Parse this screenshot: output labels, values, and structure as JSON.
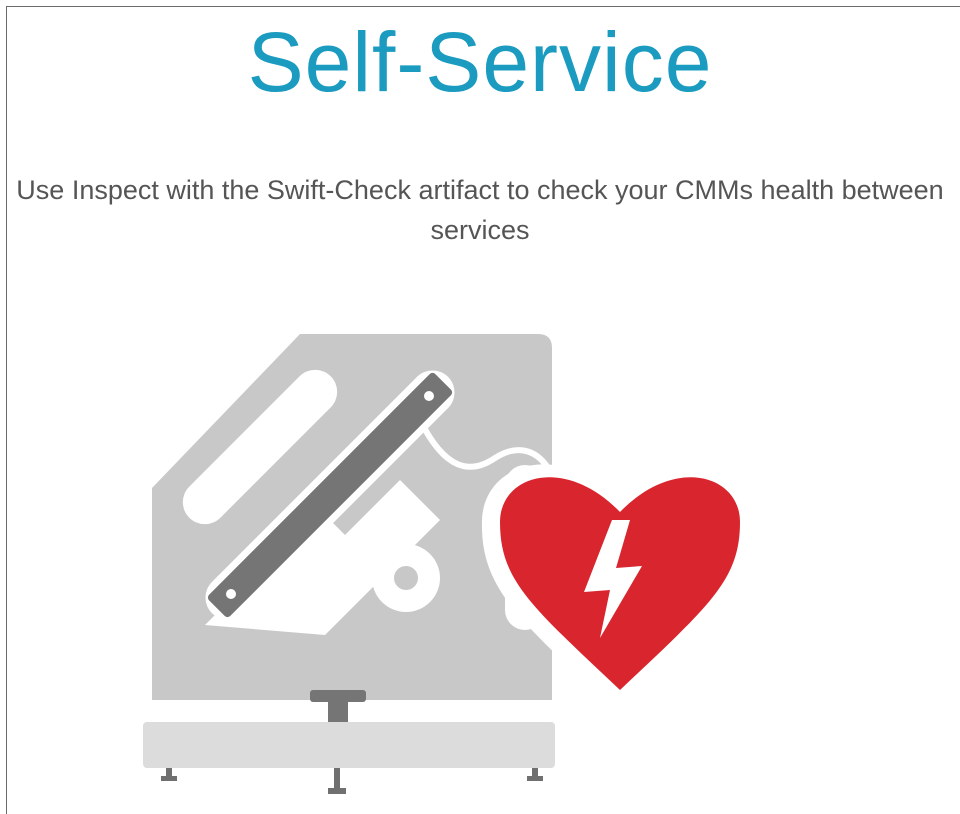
{
  "page": {
    "title": "Self-Service",
    "subtitle": "Use Inspect with the Swift-Check artifact to check your CMMs health between services"
  },
  "illustration": {
    "machine_icon": "cmm-artifact-icon",
    "heart_icon": "heart-lightning-icon",
    "colors": {
      "title": "#1a9bbf",
      "plate": "#c8c8c8",
      "bar": "#757575",
      "base": "#dcdcdc",
      "heart": "#d9262e"
    }
  }
}
